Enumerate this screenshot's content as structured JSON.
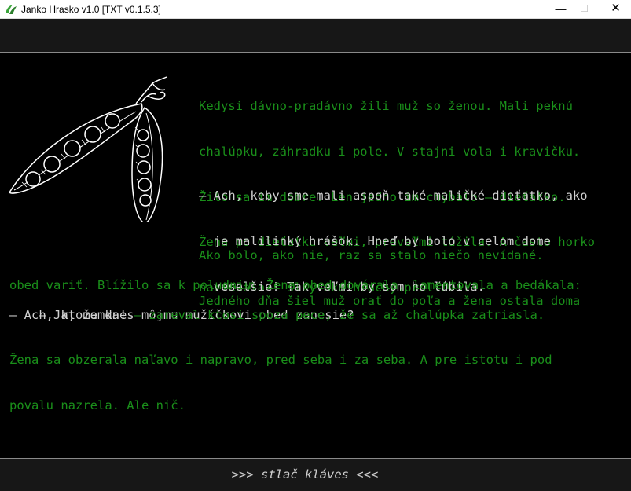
{
  "window": {
    "title": "Janko Hrasko v1.0 [TXT v0.1.5.3]",
    "min": "—",
    "max": "☐",
    "close": "✕"
  },
  "story": {
    "p1": [
      "Kedysi dávno-pradávno žili muž so ženou. Mali peknú",
      "chalúpku, záhradku i pole. V stajni vola i kravičku.",
      "Žilo sa im dobre. Len jedno im chýbalo – dieťatko.",
      "Žena po dieťatku veľmi, preveľmi túžila. A často horko",
      "nariekala – slzy ako hrachy prelieva:"
    ],
    "q1": [
      "– Ach, keby sme mali aspoň také maličké dieťatko, ako",
      "  je malilinký hrášok. Hneď by bolo v celom dome",
      "  veselšie! Tak veľmi by som ho ľúbila."
    ],
    "p2": [
      "Ako bolo, ako nie, raz sa stalo niečo nevídané.",
      "Jedného dňa šiel muž orať do poľa a žena ostala doma",
      "obed variť. Blížilo sa k poludniu. Žena obed dovárala, lamentovala a bedákala:"
    ],
    "q2": "– Ach, ktože dnes môjmu mužíčkovi obed zanesie?",
    "q3_bright": "– Ja, mamka!",
    "q3_rest": " – zareval ktosi spoza pece, že sa až chalúpka zatriasla.",
    "p3": [
      "Žena sa obzerala naľavo i napravo, pred seba i za seba. A pre istotu i pod",
      "povalu nazrela. Ale nič."
    ]
  },
  "prompt": ">>> stlač kláves <<<",
  "colors": {
    "story_green": "#1a8f1a",
    "speech_white": "#d0d0d0",
    "bar_bg": "#171717"
  },
  "image": "pea-pod-illustration"
}
